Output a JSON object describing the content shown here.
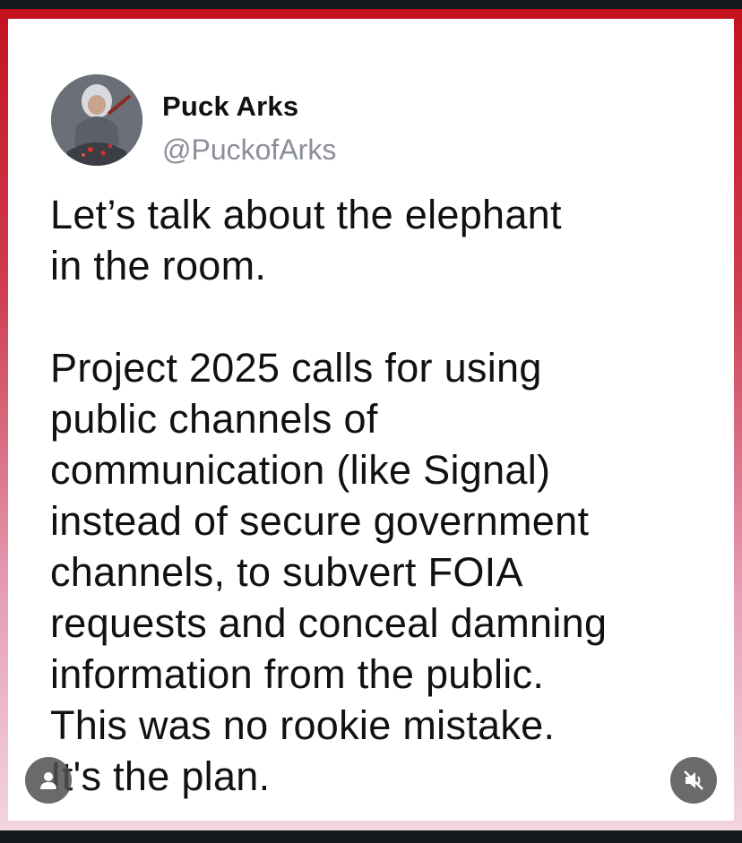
{
  "author": {
    "display_name": "Puck Arks",
    "handle": "@PuckofArks"
  },
  "post": {
    "paragraph_1": [
      "Let’s talk about the elephant",
      "in the room."
    ],
    "paragraph_2": [
      "Project 2025 calls for using",
      "public channels of",
      "communication (like Signal)",
      "instead of secure government",
      "channels, to subvert FOIA",
      "requests and conceal damning",
      "information from the public.",
      "This was no rookie mistake.",
      "It's the plan."
    ]
  },
  "overlay": {
    "left_icon": "user-icon",
    "right_icon": "muted-speaker-icon"
  },
  "colors": {
    "frame_top": "#c4121f",
    "frame_bottom": "#f3d4df",
    "handle": "#8a8f98",
    "text": "#111111"
  }
}
